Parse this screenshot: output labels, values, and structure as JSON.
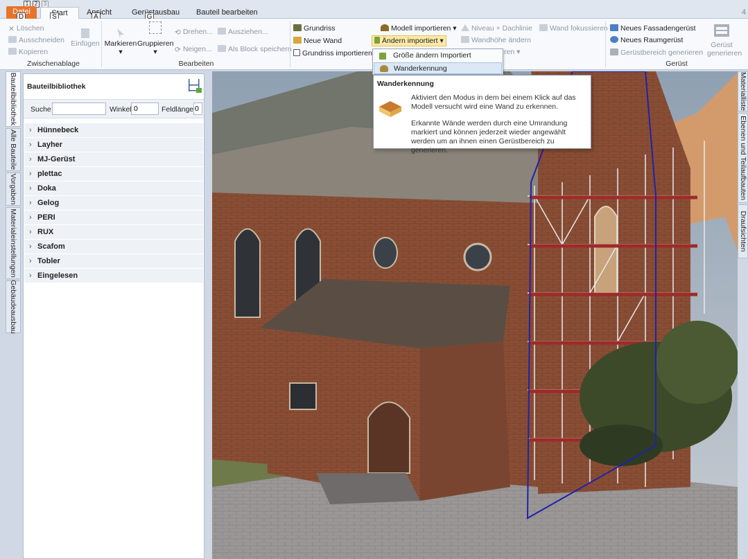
{
  "tabs": {
    "datei": "Datei",
    "start": "Start",
    "ansicht": "Ansicht",
    "geruestausbau": "Gerüstausbau",
    "bauteil_bearbeiten": "Bauteil bearbeiten",
    "overflow": "4"
  },
  "keytips": {
    "datei": "D",
    "start": "S",
    "ansicht": "A",
    "geruestausbau": "G",
    "qat1": "1",
    "qat2": "2",
    "qat3": "3"
  },
  "ribbon": {
    "clipboard": {
      "loeschen": "Löschen",
      "ausschneiden": "Ausschneiden",
      "kopieren": "Kopieren",
      "einfuegen": "Einfügen",
      "group": "Zwischenablage"
    },
    "edit": {
      "markieren": "Markieren",
      "gruppieren": "Gruppieren",
      "drehen": "Drehen...",
      "neigen": "Neigen...",
      "ausziehen": "Ausziehen...",
      "als_block": "Als Block speichern",
      "group": "Bearbeiten"
    },
    "model": {
      "grundriss": "Grundriss",
      "neue_wand": "Neue Wand",
      "grundriss_importieren": "Grundriss importieren",
      "modell_importieren": "Modell importieren",
      "aendern_importiert": "Ändern importiert",
      "niveau_dachlinie": "Niveau + Dachlinie",
      "wandhoehe_aendern": "Wandhöhe ändern",
      "partial": "ren",
      "wand_fokussieren": "Wand fokussieren"
    },
    "geruest": {
      "neues_fassadengeruest": "Neues Fassadengerüst",
      "neues_raumgeruest": "Neues Raumgerüst",
      "geruestbereich_generieren": "Gerüstbereich generieren",
      "geruest_generieren": "Gerüst generieren",
      "group": "Gerüst"
    }
  },
  "dropdown": {
    "items": [
      "Größe ändern Importiert",
      "Wanderkennung"
    ]
  },
  "tooltip": {
    "title": "Wanderkennung",
    "p1": "Aktiviert den Modus in dem bei einem Klick auf das Modell versucht wird eine Wand zu erkennen.",
    "p2": "Erkannte Wände werden durch eine Umrandung markiert und können jederzeit wieder angewählt werden um an ihnen einen Gerüstbereich zu generieren."
  },
  "left_tabs": [
    "Bauteilbibliothek",
    "Alle Bauteile",
    "Vorgaben",
    "Materialeinstellungen",
    "Gebäudeausbau"
  ],
  "right_tabs": [
    "Materialliste",
    "Ebenen und Teilaufbauten",
    "Draufsichten"
  ],
  "library": {
    "title": "Bauteilbibliothek",
    "search_label": "Suche",
    "search_value": "",
    "winkel_label": "Winkel",
    "winkel_value": "0",
    "feldlaenge_label": "Feldlänge",
    "feldlaenge_value": "0",
    "items": [
      "Hünnebeck",
      "Layher",
      "MJ-Gerüst",
      "plettac",
      "Doka",
      "Gelog",
      "PERI",
      "RUX",
      "Scafom",
      "Tobler",
      "Eingelesen"
    ]
  }
}
